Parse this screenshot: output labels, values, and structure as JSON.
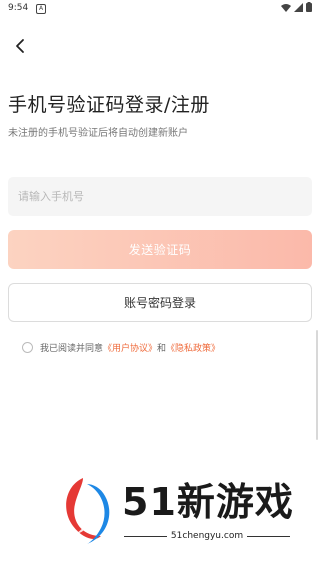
{
  "status": {
    "time": "9:54",
    "notif": "A"
  },
  "header": {
    "title": "手机号验证码登录/注册",
    "subtitle": "未注册的手机号验证后将自动创建新账户"
  },
  "form": {
    "phone_placeholder": "请输入手机号",
    "send_code_label": "发送验证码",
    "password_login_label": "账号密码登录"
  },
  "agreement": {
    "prefix": "我已阅读并同意",
    "user_agreement": "《用户协议》",
    "and": "和",
    "privacy_policy": "《隐私政策》"
  },
  "watermark": {
    "brand": "51新游戏",
    "url": "51chengyu.com"
  },
  "colors": {
    "accent": "#ef6b3c",
    "button_gradient_start": "#fcd3c1",
    "button_gradient_end": "#fbb9aa"
  }
}
